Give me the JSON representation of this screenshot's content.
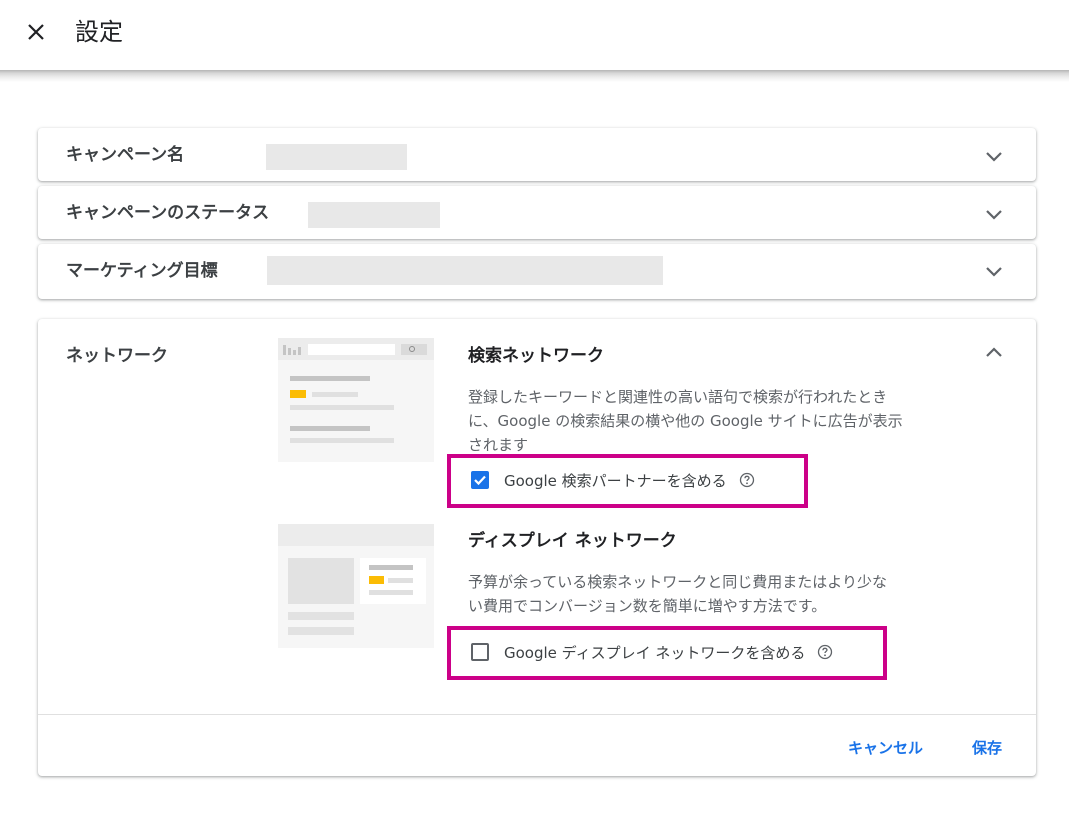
{
  "header": {
    "title": "設定"
  },
  "collapsed_rows": [
    {
      "label": "キャンペーン名"
    },
    {
      "label": "キャンペーンのステータス"
    },
    {
      "label": "マーケティング目標"
    }
  ],
  "network": {
    "label": "ネットワーク",
    "search": {
      "title": "検索ネットワーク",
      "desc_lines": [
        "登録したキーワードと関連性の高い語句で検索が行われたとき",
        "に、Google の検索結果の横や他の Google サイトに広告が表示",
        "されます"
      ],
      "option_label": "Google 検索パートナーを含める",
      "checked": true
    },
    "display": {
      "title": "ディスプレイ ネットワーク",
      "desc_lines": [
        "予算が余っている検索ネットワークと同じ費用またはより少な",
        "い費用でコンバージョン数を簡単に増やす方法です。"
      ],
      "option_label": "Google ディスプレイ ネットワークを含める",
      "checked": false
    }
  },
  "actions": {
    "cancel": "キャンセル",
    "save": "保存"
  },
  "colors": {
    "accent": "#1a73e8",
    "highlight": "#cc0088",
    "redacted": "#e8e8e8",
    "illustration_accent": "#fbbc04"
  },
  "icons": {
    "close": "close-icon",
    "expand": "chevron-down-icon",
    "collapse": "chevron-up-icon",
    "help": "help-icon",
    "check": "check-icon"
  }
}
